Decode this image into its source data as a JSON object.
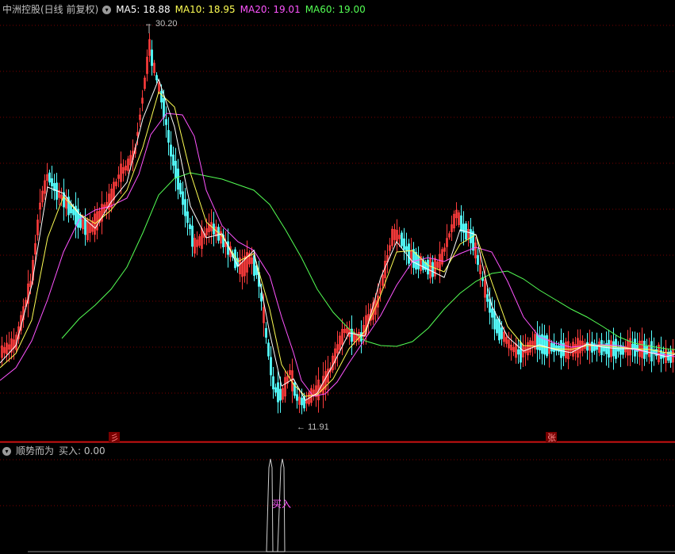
{
  "stock": {
    "title": "中洲控股(日线 前复权)",
    "ma5": "MA5: 18.88",
    "ma10": "MA10: 18.95",
    "ma20": "MA20: 19.01",
    "ma60": "MA60: 19.00",
    "high_label": "30.20",
    "low_label": "11.91",
    "marker_left": "彡",
    "marker_right": "张"
  },
  "indicator": {
    "title": "顺势而为",
    "buy_value": "买入: 0.00",
    "signal_label": "买入"
  },
  "colors": {
    "up": "#ff3c3c",
    "down": "#54ffff",
    "ma5": "#ffffff",
    "ma10": "#ffff54",
    "ma20": "#ff54ff",
    "ma60": "#54ff54",
    "grid": "#7a0000",
    "text": "#c0c0c0"
  },
  "chart_data": {
    "type": "candlestick",
    "series": [
      {
        "name": "MA5",
        "value": 18.88
      },
      {
        "name": "MA10",
        "value": 18.95
      },
      {
        "name": "MA20",
        "value": 19.01
      },
      {
        "name": "MA60",
        "value": 19.0
      }
    ],
    "price_high": 30.2,
    "price_low": 11.91,
    "ma60_path": [
      [
        78,
        427
      ],
      [
        100,
        402
      ],
      [
        120,
        385
      ],
      [
        140,
        365
      ],
      [
        160,
        337
      ],
      [
        180,
        294
      ],
      [
        200,
        246
      ],
      [
        220,
        225
      ],
      [
        240,
        218
      ],
      [
        260,
        222
      ],
      [
        280,
        226
      ],
      [
        300,
        233
      ],
      [
        320,
        240
      ],
      [
        340,
        258
      ],
      [
        360,
        290
      ],
      [
        380,
        325
      ],
      [
        400,
        365
      ],
      [
        420,
        394
      ],
      [
        440,
        415
      ],
      [
        460,
        430
      ],
      [
        480,
        436
      ],
      [
        500,
        437
      ],
      [
        520,
        431
      ],
      [
        540,
        414
      ],
      [
        560,
        390
      ],
      [
        580,
        370
      ],
      [
        600,
        355
      ],
      [
        620,
        345
      ],
      [
        640,
        342
      ],
      [
        660,
        352
      ],
      [
        680,
        366
      ],
      [
        700,
        378
      ],
      [
        720,
        390
      ],
      [
        740,
        400
      ],
      [
        760,
        412
      ],
      [
        780,
        425
      ],
      [
        800,
        433
      ],
      [
        820,
        437
      ],
      [
        840,
        440
      ],
      [
        851,
        441
      ]
    ],
    "ma20_path": [
      [
        0,
        480
      ],
      [
        20,
        464
      ],
      [
        40,
        430
      ],
      [
        60,
        378
      ],
      [
        80,
        318
      ],
      [
        100,
        277
      ],
      [
        120,
        265
      ],
      [
        140,
        260
      ],
      [
        160,
        250
      ],
      [
        175,
        220
      ],
      [
        190,
        170
      ],
      [
        210,
        143
      ],
      [
        230,
        145
      ],
      [
        245,
        172
      ],
      [
        260,
        240
      ],
      [
        280,
        285
      ],
      [
        300,
        305
      ],
      [
        320,
        316
      ],
      [
        340,
        348
      ],
      [
        355,
        400
      ],
      [
        370,
        445
      ],
      [
        380,
        480
      ],
      [
        395,
        500
      ],
      [
        410,
        497
      ],
      [
        425,
        482
      ],
      [
        440,
        458
      ],
      [
        460,
        428
      ],
      [
        480,
        398
      ],
      [
        500,
        360
      ],
      [
        520,
        330
      ],
      [
        540,
        325
      ],
      [
        560,
        330
      ],
      [
        580,
        320
      ],
      [
        600,
        312
      ],
      [
        620,
        318
      ],
      [
        640,
        355
      ],
      [
        660,
        400
      ],
      [
        680,
        425
      ],
      [
        700,
        433
      ],
      [
        720,
        438
      ],
      [
        740,
        436
      ],
      [
        760,
        435
      ],
      [
        780,
        436
      ],
      [
        800,
        441
      ],
      [
        820,
        445
      ],
      [
        840,
        448
      ],
      [
        851,
        450
      ]
    ],
    "ma10_path": [
      [
        0,
        464
      ],
      [
        20,
        446
      ],
      [
        40,
        404
      ],
      [
        60,
        300
      ],
      [
        80,
        248
      ],
      [
        100,
        270
      ],
      [
        120,
        282
      ],
      [
        140,
        265
      ],
      [
        160,
        240
      ],
      [
        180,
        186
      ],
      [
        200,
        116
      ],
      [
        220,
        135
      ],
      [
        240,
        218
      ],
      [
        260,
        280
      ],
      [
        280,
        298
      ],
      [
        300,
        330
      ],
      [
        320,
        320
      ],
      [
        340,
        390
      ],
      [
        355,
        460
      ],
      [
        370,
        485
      ],
      [
        385,
        500
      ],
      [
        400,
        498
      ],
      [
        420,
        478
      ],
      [
        440,
        440
      ],
      [
        460,
        418
      ],
      [
        480,
        372
      ],
      [
        500,
        318
      ],
      [
        520,
        316
      ],
      [
        540,
        335
      ],
      [
        560,
        343
      ],
      [
        580,
        308
      ],
      [
        600,
        296
      ],
      [
        620,
        356
      ],
      [
        640,
        412
      ],
      [
        660,
        436
      ],
      [
        680,
        437
      ],
      [
        700,
        440
      ],
      [
        720,
        441
      ],
      [
        740,
        436
      ],
      [
        760,
        436
      ],
      [
        780,
        438
      ],
      [
        800,
        440
      ],
      [
        820,
        441
      ],
      [
        840,
        445
      ],
      [
        851,
        446
      ]
    ],
    "ma5_path": [
      [
        0,
        458
      ],
      [
        20,
        436
      ],
      [
        40,
        360
      ],
      [
        60,
        236
      ],
      [
        80,
        244
      ],
      [
        100,
        270
      ],
      [
        120,
        288
      ],
      [
        140,
        255
      ],
      [
        160,
        230
      ],
      [
        180,
        150
      ],
      [
        200,
        100
      ],
      [
        220,
        160
      ],
      [
        240,
        260
      ],
      [
        260,
        300
      ],
      [
        280,
        295
      ],
      [
        300,
        336
      ],
      [
        320,
        316
      ],
      [
        340,
        420
      ],
      [
        355,
        487
      ],
      [
        370,
        478
      ],
      [
        385,
        505
      ],
      [
        400,
        496
      ],
      [
        420,
        460
      ],
      [
        440,
        420
      ],
      [
        460,
        424
      ],
      [
        480,
        350
      ],
      [
        500,
        305
      ],
      [
        520,
        330
      ],
      [
        540,
        340
      ],
      [
        560,
        350
      ],
      [
        580,
        290
      ],
      [
        600,
        296
      ],
      [
        620,
        386
      ],
      [
        640,
        425
      ],
      [
        660,
        443
      ],
      [
        680,
        435
      ],
      [
        700,
        441
      ],
      [
        720,
        445
      ],
      [
        740,
        434
      ],
      [
        760,
        438
      ],
      [
        780,
        440
      ],
      [
        800,
        440
      ],
      [
        820,
        445
      ],
      [
        840,
        450
      ],
      [
        851,
        447
      ]
    ],
    "candle_profile": [
      [
        0,
        445
      ],
      [
        20,
        432
      ],
      [
        40,
        350
      ],
      [
        50,
        260
      ],
      [
        60,
        220
      ],
      [
        70,
        240
      ],
      [
        80,
        252
      ],
      [
        90,
        265
      ],
      [
        100,
        278
      ],
      [
        110,
        290
      ],
      [
        120,
        282
      ],
      [
        130,
        265
      ],
      [
        140,
        250
      ],
      [
        150,
        220
      ],
      [
        160,
        210
      ],
      [
        170,
        190
      ],
      [
        180,
        120
      ],
      [
        188,
        60
      ],
      [
        195,
        90
      ],
      [
        205,
        130
      ],
      [
        215,
        190
      ],
      [
        225,
        230
      ],
      [
        235,
        270
      ],
      [
        245,
        310
      ],
      [
        255,
        300
      ],
      [
        265,
        285
      ],
      [
        275,
        295
      ],
      [
        285,
        310
      ],
      [
        295,
        325
      ],
      [
        305,
        340
      ],
      [
        315,
        325
      ],
      [
        325,
        345
      ],
      [
        335,
        420
      ],
      [
        345,
        490
      ],
      [
        355,
        500
      ],
      [
        365,
        470
      ],
      [
        375,
        505
      ],
      [
        385,
        508
      ],
      [
        395,
        495
      ],
      [
        405,
        490
      ],
      [
        415,
        470
      ],
      [
        425,
        440
      ],
      [
        435,
        415
      ],
      [
        445,
        425
      ],
      [
        455,
        425
      ],
      [
        465,
        400
      ],
      [
        475,
        385
      ],
      [
        485,
        340
      ],
      [
        495,
        295
      ],
      [
        505,
        300
      ],
      [
        515,
        320
      ],
      [
        525,
        330
      ],
      [
        535,
        335
      ],
      [
        545,
        340
      ],
      [
        555,
        330
      ],
      [
        565,
        300
      ],
      [
        575,
        270
      ],
      [
        585,
        290
      ],
      [
        595,
        300
      ],
      [
        605,
        340
      ],
      [
        615,
        380
      ],
      [
        625,
        410
      ],
      [
        635,
        425
      ],
      [
        645,
        440
      ],
      [
        655,
        445
      ],
      [
        665,
        440
      ],
      [
        675,
        430
      ],
      [
        685,
        435
      ],
      [
        695,
        438
      ],
      [
        705,
        440
      ],
      [
        715,
        442
      ],
      [
        725,
        440
      ],
      [
        735,
        436
      ],
      [
        745,
        438
      ],
      [
        755,
        438
      ],
      [
        765,
        440
      ],
      [
        775,
        440
      ],
      [
        785,
        442
      ],
      [
        795,
        437
      ],
      [
        805,
        440
      ],
      [
        815,
        442
      ],
      [
        825,
        444
      ],
      [
        835,
        448
      ],
      [
        845,
        450
      ],
      [
        851,
        448
      ]
    ]
  }
}
